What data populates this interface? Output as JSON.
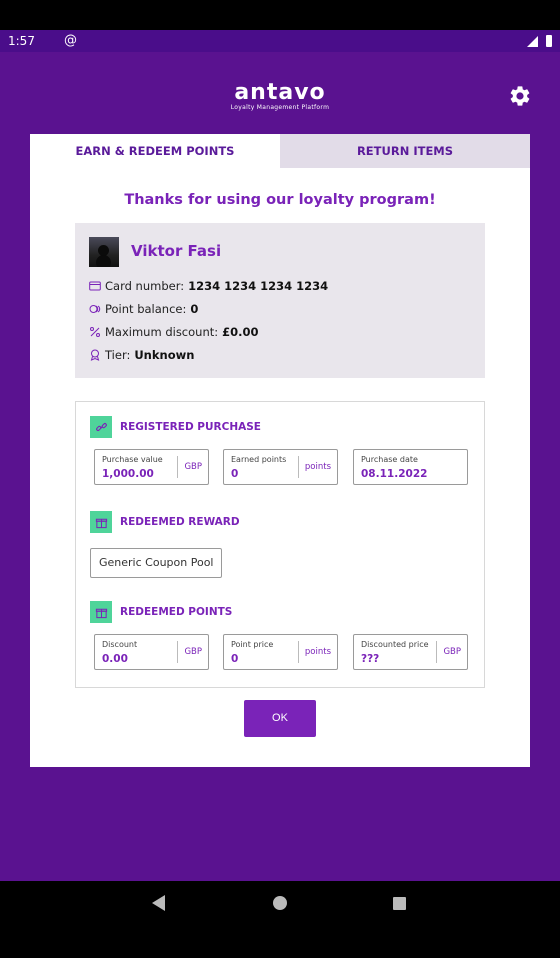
{
  "status": {
    "time": "1:57"
  },
  "brand": {
    "name": "antavo",
    "tagline": "Loyalty Management Platform"
  },
  "tabs": [
    {
      "label": "EARN & REDEEM POINTS"
    },
    {
      "label": "RETURN ITEMS"
    }
  ],
  "heading": "Thanks for using our loyalty program!",
  "profile": {
    "name": "Viktor Fasi",
    "card_label": "Card number:",
    "card_value": "1234 1234 1234 1234",
    "balance_label": "Point balance:",
    "balance_value": "0",
    "discount_label": "Maximum discount:",
    "discount_value": "£0.00",
    "tier_label": "Tier:",
    "tier_value": "Unknown"
  },
  "registered_purchase": {
    "title": "REGISTERED PURCHASE",
    "purchase_value": {
      "label": "Purchase value",
      "value": "1,000.00",
      "unit": "GBP"
    },
    "earned_points": {
      "label": "Earned points",
      "value": "0",
      "unit": "points"
    },
    "purchase_date": {
      "label": "Purchase date",
      "value": "08.11.2022"
    }
  },
  "redeemed_reward": {
    "title": "REDEEMED REWARD",
    "coupon": "Generic Coupon Pool"
  },
  "redeemed_points": {
    "title": "REDEEMED POINTS",
    "discount": {
      "label": "Discount",
      "value": "0.00",
      "unit": "GBP"
    },
    "point_price": {
      "label": "Point price",
      "value": "0",
      "unit": "points"
    },
    "discounted_price": {
      "label": "Discounted price",
      "value": "???",
      "unit": "GBP"
    }
  },
  "ok_label": "OK",
  "colors": {
    "primary": "#7a23b8",
    "background": "#5a1290",
    "accent": "#4fd49a"
  }
}
